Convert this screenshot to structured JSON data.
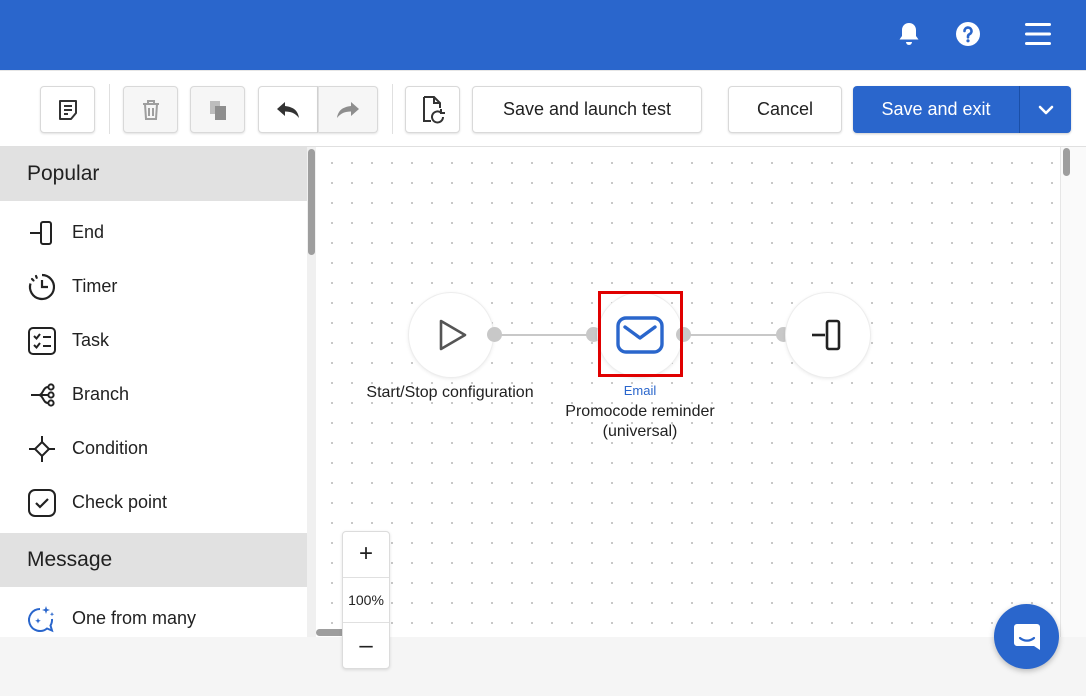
{
  "header": {
    "icons": [
      "bell-icon",
      "help-icon",
      "menu-icon"
    ]
  },
  "toolbar": {
    "save_launch_label": "Save and launch test",
    "cancel_label": "Cancel",
    "save_exit_label": "Save and exit",
    "icons": [
      "notes-icon",
      "trash-icon",
      "copy-icon",
      "undo-icon",
      "redo-icon",
      "restore-document-icon",
      "chevron-down-icon"
    ]
  },
  "sidebar": {
    "sections": [
      {
        "title": "Popular",
        "items": [
          {
            "label": "End",
            "icon": "end-icon"
          },
          {
            "label": "Timer",
            "icon": "timer-icon"
          },
          {
            "label": "Task",
            "icon": "task-icon"
          },
          {
            "label": "Branch",
            "icon": "branch-icon"
          },
          {
            "label": "Condition",
            "icon": "condition-icon"
          },
          {
            "label": "Check point",
            "icon": "checkpoint-icon"
          }
        ]
      },
      {
        "title": "Message",
        "items": [
          {
            "label": "One from many",
            "icon": "sparkle-chat-icon"
          }
        ]
      }
    ]
  },
  "canvas": {
    "nodes": [
      {
        "label": "Start/Stop configuration",
        "icon": "play-icon"
      },
      {
        "type": "Email",
        "label_line1": "Promocode reminder",
        "label_line2": "(universal)",
        "icon": "mail-icon"
      },
      {
        "label": "",
        "icon": "end-icon"
      }
    ],
    "zoom": {
      "value": "100%",
      "plus": "+",
      "minus": "–"
    }
  },
  "colors": {
    "brand": "#2a66cc",
    "highlight": "#e00000"
  }
}
